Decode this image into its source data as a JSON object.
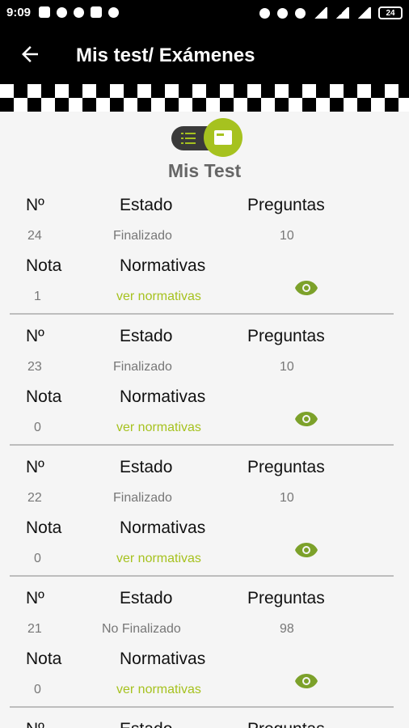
{
  "status_bar": {
    "time": "9:09",
    "battery": "24"
  },
  "app_bar": {
    "title": "Mis test/ Exámenes"
  },
  "section_title": "Mis Test",
  "labels": {
    "num": "Nº",
    "estado": "Estado",
    "preguntas": "Preguntas",
    "nota": "Nota",
    "normativas": "Normativas"
  },
  "tests": [
    {
      "num": "24",
      "estado": "Finalizado",
      "preguntas": "10",
      "nota": "1",
      "normativas_link": "ver normativas"
    },
    {
      "num": "23",
      "estado": "Finalizado",
      "preguntas": "10",
      "nota": "0",
      "normativas_link": "ver normativas"
    },
    {
      "num": "22",
      "estado": "Finalizado",
      "preguntas": "10",
      "nota": "0",
      "normativas_link": "ver normativas"
    },
    {
      "num": "21",
      "estado": "No Finalizado",
      "preguntas": "98",
      "nota": "0",
      "normativas_link": "ver normativas"
    }
  ],
  "colors": {
    "accent": "#a6c21f",
    "bar": "#000000",
    "background": "#f5f5f5"
  },
  "icons": {
    "back": "arrow-left-icon",
    "view": "eye-icon",
    "list": "list-icon",
    "card": "card-icon"
  }
}
